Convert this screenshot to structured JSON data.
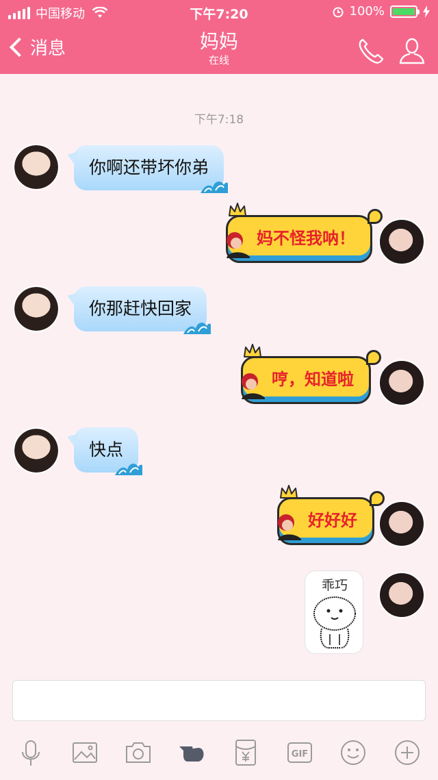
{
  "status_bar": {
    "carrier": "中国移动",
    "time": "下午7:20",
    "battery": "100%",
    "battery_level": 1.0,
    "accent": "#f4678b"
  },
  "header": {
    "back_label": "消息",
    "title": "妈妈",
    "subtitle": "在线",
    "icons": [
      "phone-icon",
      "contact-icon"
    ]
  },
  "chat": {
    "timestamp": "下午7:18",
    "messages": [
      {
        "sender": "mom",
        "type": "text",
        "text": "你啊还带坏你弟"
      },
      {
        "sender": "me",
        "type": "text",
        "text": "妈不怪我呐！"
      },
      {
        "sender": "mom",
        "type": "text",
        "text": "你那赶快回家"
      },
      {
        "sender": "me",
        "type": "text",
        "text": "哼，知道啦"
      },
      {
        "sender": "mom",
        "type": "text",
        "text": "快点"
      },
      {
        "sender": "me",
        "type": "text",
        "text": "好好好"
      },
      {
        "sender": "me",
        "type": "sticker",
        "text": "乖巧"
      }
    ],
    "incoming_color": "#a9d8fb",
    "outgoing_color": "#ffd43a",
    "outgoing_text_color": "#e7222a"
  },
  "input": {
    "value": "",
    "placeholder": ""
  },
  "toolbar": {
    "items": [
      "microphone-icon",
      "image-icon",
      "camera-icon",
      "poke-icon",
      "red-packet-icon",
      "gif-icon",
      "emoji-icon",
      "plus-icon"
    ]
  }
}
